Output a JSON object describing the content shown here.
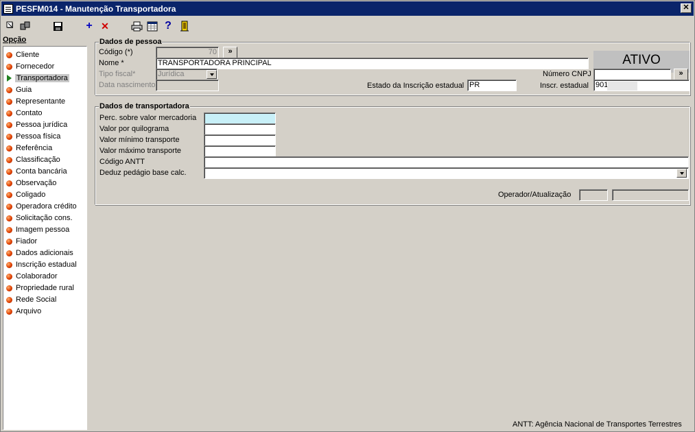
{
  "window": {
    "title": "PESFM014 - Manutenção Transportadora",
    "close": "✕"
  },
  "toolbar": {
    "icons": [
      "first-icon",
      "previous-icon",
      "save-icon",
      "add-icon",
      "delete-icon",
      "print-icon",
      "grid-icon",
      "help-icon",
      "exit-icon"
    ],
    "add_glyph": "+",
    "delete_glyph": "✕",
    "help_glyph": "?"
  },
  "sidebar": {
    "header": "Opção",
    "items": [
      {
        "label": "Cliente"
      },
      {
        "label": "Fornecedor"
      },
      {
        "label": "Transportadora",
        "selected": true
      },
      {
        "label": "Guia"
      },
      {
        "label": "Representante"
      },
      {
        "label": "Contato"
      },
      {
        "label": "Pessoa jurídica"
      },
      {
        "label": "Pessoa física"
      },
      {
        "label": "Referência"
      },
      {
        "label": "Classificação"
      },
      {
        "label": "Conta bancária"
      },
      {
        "label": "Observação"
      },
      {
        "label": "Coligado"
      },
      {
        "label": "Operadora crédito"
      },
      {
        "label": "Solicitação cons."
      },
      {
        "label": "Imagem pessoa"
      },
      {
        "label": "Fiador"
      },
      {
        "label": "Dados adicionais"
      },
      {
        "label": "Inscrição estadual"
      },
      {
        "label": "Colaborador"
      },
      {
        "label": "Propriedade rural"
      },
      {
        "label": "Rede Social"
      },
      {
        "label": "Arquivo"
      }
    ]
  },
  "pessoa": {
    "legend": "Dados de pessoa",
    "codigo_label": "Código (*)",
    "codigo_value": "70",
    "lookup_btn": "»",
    "nome_label": "Nome *",
    "nome_value": "TRANSPORTADORA PRINCIPAL",
    "tipo_fiscal_label": "Tipo fiscal*",
    "tipo_fiscal_value": "Jurídica",
    "data_nasc_label": "Data nascimento",
    "data_nasc_value": "",
    "estado_ie_label": "Estado da Inscrição estadual",
    "estado_ie_value": "PR",
    "status": "ATIVO",
    "cnpj_label": "Número CNPJ",
    "cnpj_value": "",
    "cnpj_btn": "»",
    "inscr_label": "Inscr. estadual",
    "inscr_value": "901"
  },
  "transp": {
    "legend": "Dados de transportadora",
    "perc_label": "Perc. sobre valor mercadoria",
    "perc_value": "",
    "kg_label": "Valor por quilograma",
    "kg_value": "",
    "min_label": "Valor mínimo transporte",
    "min_value": "",
    "max_label": "Valor máximo transporte",
    "max_value": "",
    "antt_label": "Código ANTT",
    "antt_value": "",
    "pedagio_label": "Deduz pedágio base calc.",
    "pedagio_value": "",
    "operador_label": "Operador/Atualização",
    "operador_value": "",
    "atualizacao_value": ""
  },
  "footer": {
    "note": "ANTT: Agência Nacional de Transportes Terrestres"
  }
}
